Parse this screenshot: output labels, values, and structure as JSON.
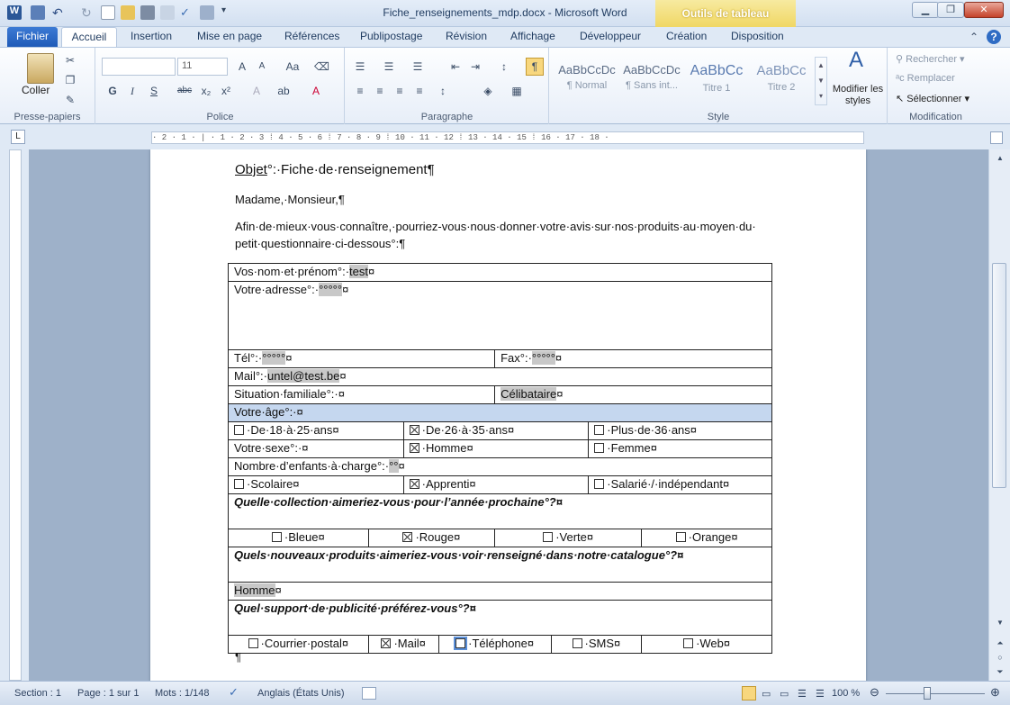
{
  "window": {
    "title": "Fiche_renseignements_mdp.docx - Microsoft Word",
    "tools_tab": "Outils de tableau"
  },
  "tabs": [
    "Fichier",
    "Accueil",
    "Insertion",
    "Mise en page",
    "Références",
    "Publipostage",
    "Révision",
    "Affichage",
    "Développeur",
    "Création",
    "Disposition"
  ],
  "ribbon": {
    "clipboard": {
      "label": "Presse-papiers",
      "paste": "Coller"
    },
    "font": {
      "label": "Police",
      "size": "11",
      "bold": "G",
      "italic": "I",
      "underline": "S",
      "strike": "abc"
    },
    "paragraph": {
      "label": "Paragraphe"
    },
    "styles": {
      "label": "Style",
      "items": [
        {
          "preview": "AaBbCcDc",
          "name": "¶ Normal"
        },
        {
          "preview": "AaBbCcDc",
          "name": "¶ Sans int..."
        },
        {
          "preview": "AaBbCc",
          "name": "Titre 1"
        },
        {
          "preview": "AaBbCc",
          "name": "Titre 2"
        }
      ],
      "modify": "Modifier les styles"
    },
    "editing": {
      "label": "Modification",
      "find": "Rechercher",
      "replace": "Remplacer",
      "select": "Sélectionner"
    }
  },
  "ruler": "· 2 · 1 · | · 1 · 2 · 3 ⁞ 4 · 5 · 6 ⁞ 7 · 8 · 9 ⁞ 10 · 11 · 12 ⁞ 13 · 14 · 15 ⁞ 16 · 17 · 18 ·",
  "document": {
    "objet_label": "Objet",
    "objet_rest": "°:·Fiche·de·renseignement¶",
    "greeting": "Madame,·Monsieur,¶",
    "intro1": "Afin·de·mieux·vous·connaître,·pourriez-vous·nous·donner·votre·avis·sur·nos·produits·au·moyen·du·",
    "intro2": "petit·questionnaire·ci-dessous°:¶",
    "end_para": "¶",
    "cellmark": "¤",
    "table": {
      "name_label": "Vos·nom·et·prénom°:·",
      "name_value": "test",
      "address_label": "Votre·adresse°:·",
      "address_value": "°°°°°",
      "tel_label": "Tél°:·",
      "tel_value": "°°°°°",
      "fax_label": "Fax°:·",
      "fax_value": "°°°°°",
      "mail_label": "Mail°:·",
      "mail_value": "untel@test.be",
      "family_label": "Situation·familiale°:·",
      "family_value": "Célibataire",
      "age_label": "Votre·âge°:·",
      "age_options": [
        {
          "label": "·De·18·à·25·ans",
          "checked": false
        },
        {
          "label": "·De·26·à·35·ans",
          "checked": true
        },
        {
          "label": "·Plus·de·36·ans",
          "checked": false
        }
      ],
      "sex_label": "Votre·sexe°:·",
      "sex_options": [
        {
          "label": "·Homme",
          "checked": true
        },
        {
          "label": "·Femme",
          "checked": false
        }
      ],
      "children_label": "Nombre·d’enfants·à·charge°:·",
      "children_value": "°°",
      "status_options": [
        {
          "label": "·Scolaire",
          "checked": false
        },
        {
          "label": "·Apprenti",
          "checked": true
        },
        {
          "label": "·Salarié·/·indépendant",
          "checked": false
        }
      ],
      "q1": "Quelle·collection·aimeriez-vous·pour·l’année·prochaine°?",
      "colors": [
        {
          "label": "·Bleue",
          "checked": false
        },
        {
          "label": "·Rouge",
          "checked": true
        },
        {
          "label": "·Verte",
          "checked": false
        },
        {
          "label": "·Orange",
          "checked": false
        }
      ],
      "q2": "Quels·nouveaux·produits·aimeriez-vous·voir·renseigné·dans·notre·catalogue°?",
      "q2_answer": "Homme",
      "q3": "Quel·support·de·publicité·préférez-vous°?",
      "media": [
        {
          "label": "·Courrier·postal",
          "checked": false
        },
        {
          "label": "·Mail",
          "checked": true
        },
        {
          "label": "·Téléphone",
          "checked": false
        },
        {
          "label": "·SMS",
          "checked": false
        },
        {
          "label": "·Web",
          "checked": false
        }
      ]
    }
  },
  "status": {
    "section": "Section : 1",
    "page": "Page : 1 sur 1",
    "words": "Mots : 1/148",
    "lang": "Anglais (États Unis)",
    "zoom": "100 %"
  }
}
